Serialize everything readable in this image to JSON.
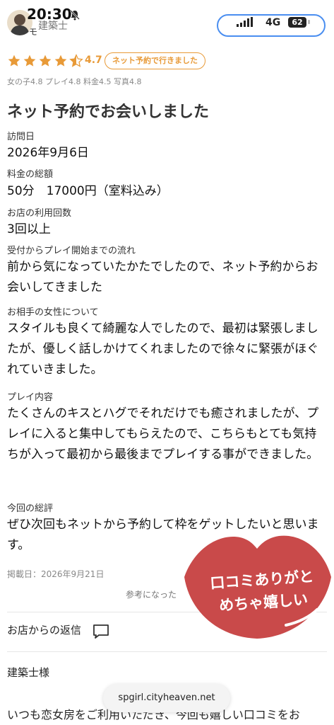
{
  "status": {
    "time": "20:30",
    "network": "4G",
    "battery": "62",
    "mute_icon": "bell-slash-icon"
  },
  "reviewer": {
    "name": "建築士",
    "suffix": "モ"
  },
  "review": {
    "rating": 4.7,
    "rating_text": "4.7",
    "badge": "ネット予約で行きました",
    "subscores": "女の子4.8 プレイ4.8 料金4.5 写真4.8",
    "title": "ネット予約でお会いしました",
    "visit_date_label": "訪問日",
    "visit_date": "2026年9月6日",
    "fee_label": "料金の総額",
    "fee": "50分　17000円（室料込み）",
    "usage_label": "お店の利用回数",
    "usage": "3回以上",
    "flow_label": "受付からプレイ開始までの流れ",
    "flow_text": "前から気になっていたかたでしたので、ネット予約からお会いしてきました",
    "partner_label": "お相手の女性について",
    "partner_text": "スタイルも良くて綺麗な人でしたので、最初は緊張しましたが、優しく話しかけてくれましたので徐々に緊張がほぐれていきました。",
    "play_label": "プレイ内容",
    "play_text": "たくさんのキスとハグでそれだけでも癒されましたが、プレイに入ると集中してもらえたので、こちらもとても気持ちが入って最初から最後までプレイする事ができました。",
    "summary_label": "今回の総評",
    "summary_text": "ぜひ次回もネットから予約して枠をゲットしたいと思います。",
    "posted": "掲載日：2026年9月21日",
    "helpful": "参考になった"
  },
  "reply": {
    "section_label": "お店からの返信",
    "salutation": "建築士様",
    "body_preview": "いつも恋女房をご利用いただき、今回も嬉しい口コミをお"
  },
  "sticker": {
    "line1": "口コミありがと",
    "line2": "めちゃ嬉しい"
  },
  "browser": {
    "url": "spgirl.cityheaven.net"
  },
  "colors": {
    "accent": "#e89a38",
    "sticker_red": "#c94a4a"
  }
}
